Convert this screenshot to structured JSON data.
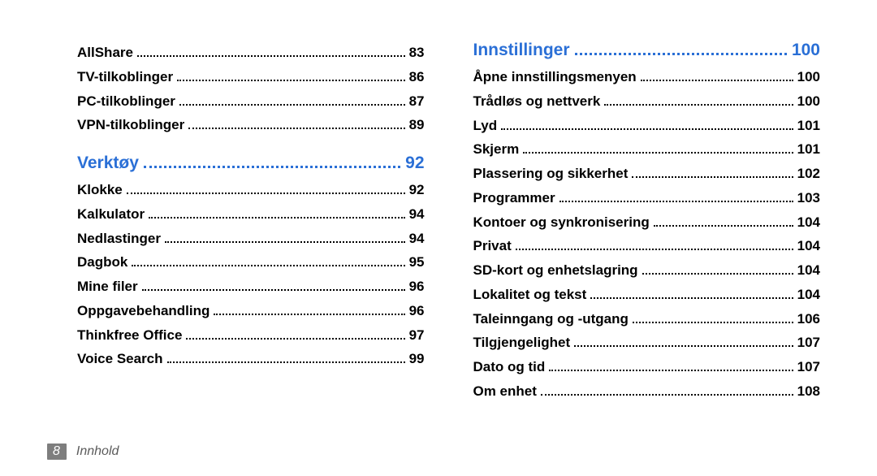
{
  "left": {
    "before_section_items": [
      {
        "title": "AllShare",
        "page": "83"
      },
      {
        "title": "TV-tilkoblinger",
        "page": "86"
      },
      {
        "title": "PC-tilkoblinger",
        "page": "87"
      },
      {
        "title": "VPN-tilkoblinger",
        "page": "89"
      }
    ],
    "section": {
      "title": "Verktøy",
      "page": "92"
    },
    "section_items": [
      {
        "title": "Klokke",
        "page": "92"
      },
      {
        "title": "Kalkulator",
        "page": "94"
      },
      {
        "title": "Nedlastinger",
        "page": "94"
      },
      {
        "title": "Dagbok",
        "page": "95"
      },
      {
        "title": "Mine filer",
        "page": "96"
      },
      {
        "title": "Oppgavebehandling",
        "page": "96"
      },
      {
        "title": "Thinkfree Office",
        "page": "97"
      },
      {
        "title": "Voice Search",
        "page": "99"
      }
    ]
  },
  "right": {
    "section": {
      "title": "Innstillinger",
      "page": "100"
    },
    "section_items": [
      {
        "title": "Åpne innstillingsmenyen",
        "page": "100"
      },
      {
        "title": "Trådløs og nettverk",
        "page": "100"
      },
      {
        "title": "Lyd",
        "page": "101"
      },
      {
        "title": "Skjerm",
        "page": "101"
      },
      {
        "title": "Plassering og sikkerhet",
        "page": "102"
      },
      {
        "title": "Programmer",
        "page": "103"
      },
      {
        "title": "Kontoer og synkronisering",
        "page": "104"
      },
      {
        "title": "Privat",
        "page": "104"
      },
      {
        "title": "SD-kort og enhetslagring",
        "page": "104"
      },
      {
        "title": "Lokalitet og tekst",
        "page": "104"
      },
      {
        "title": "Taleinngang og -utgang",
        "page": "106"
      },
      {
        "title": "Tilgjengelighet",
        "page": "107"
      },
      {
        "title": "Dato og tid",
        "page": "107"
      },
      {
        "title": "Om enhet",
        "page": "108"
      }
    ]
  },
  "footer": {
    "page_number": "8",
    "label": "Innhold"
  }
}
